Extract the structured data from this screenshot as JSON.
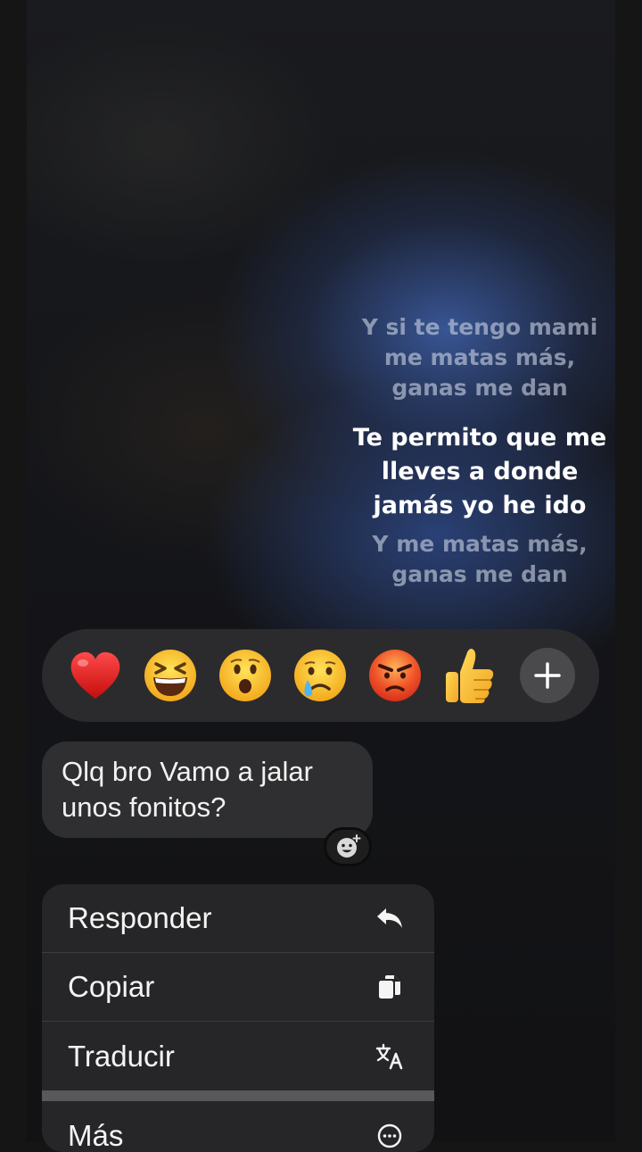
{
  "lyrics": {
    "previous": [
      "Y si te tengo mami",
      "me matas más,",
      "ganas me dan"
    ],
    "current": [
      "Te permito que me",
      "lleves a donde",
      "jamás yo he ido"
    ],
    "next": [
      "Y me matas más,",
      "ganas me dan"
    ]
  },
  "reactions": [
    {
      "name": "red-heart",
      "glyph": "❤️"
    },
    {
      "name": "grinning-squinting-face",
      "glyph": "😆"
    },
    {
      "name": "surprised-face",
      "glyph": "😮"
    },
    {
      "name": "crying-face",
      "glyph": "😢"
    },
    {
      "name": "angry-face",
      "glyph": "😡"
    },
    {
      "name": "thumbs-up",
      "glyph": "👍"
    },
    {
      "name": "plus-icon"
    }
  ],
  "message": {
    "lines": [
      "Qlq bro Vamo a jalar",
      "unos fonitos?"
    ],
    "reaction_icon": "add-reaction-icon"
  },
  "menu": {
    "items": [
      {
        "label": "Responder",
        "icon": "reply-icon"
      },
      {
        "label": "Copiar",
        "icon": "copy-icon"
      },
      {
        "label": "Traducir",
        "icon": "translate-icon"
      },
      {
        "label": "Más",
        "icon": "more-icon"
      }
    ]
  },
  "colors": {
    "background": "#151515",
    "bubble": "#2f2f31",
    "menu": "#262628",
    "accent_blue": "#3e60aa"
  }
}
